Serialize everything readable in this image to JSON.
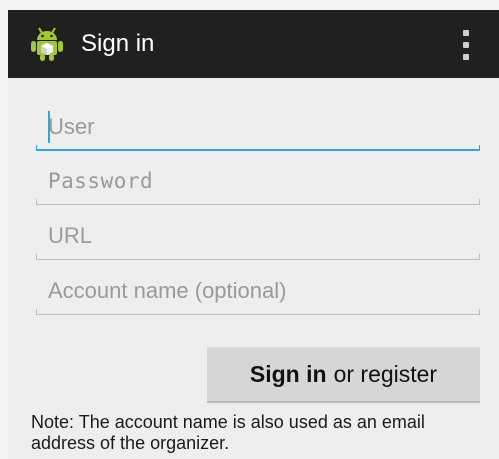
{
  "action_bar": {
    "title": "Sign in",
    "app_icon": "android-robot-icon",
    "menu_icon": "overflow-menu-icon"
  },
  "form": {
    "user": {
      "placeholder": "User",
      "value": ""
    },
    "password": {
      "placeholder": "Password",
      "value": ""
    },
    "url": {
      "placeholder": "URL",
      "value": ""
    },
    "account": {
      "placeholder": "Account name (optional)",
      "value": ""
    }
  },
  "button": {
    "label_bold": "Sign in",
    "label_rest": "or register"
  },
  "note": "Note: The account name is also used as an email address of the organizer.",
  "colors": {
    "action_bar": "#202020",
    "focus_accent": "#33a6d6",
    "android_green": "#a4c639",
    "background": "#eeeeee"
  }
}
